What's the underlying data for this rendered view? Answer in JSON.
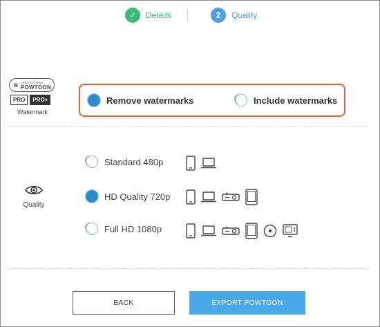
{
  "stepper": {
    "steps": [
      {
        "index": "✓",
        "label": "Details",
        "state": "complete",
        "color": "#3cb878"
      },
      {
        "index": "2",
        "label": "Quality",
        "state": "active",
        "color": "#4a9fe0"
      }
    ]
  },
  "watermark": {
    "badge_brand": "POWTOON",
    "badge_tiny": "CREATED USING",
    "plans": [
      "PRO",
      "PRO+"
    ],
    "section_label": "Watermark",
    "highlight_color": "#e8642f",
    "options": [
      {
        "label": "Remove watermarks",
        "selected": true
      },
      {
        "label": "Include watermarks",
        "selected": false
      }
    ]
  },
  "quality": {
    "section_label": "Quality",
    "section_icon": "eye-icon",
    "options": [
      {
        "label": "Standard 480p",
        "selected": false,
        "devices": [
          "phone-icon",
          "laptop-icon"
        ]
      },
      {
        "label": "HD Quality 720p",
        "selected": true,
        "devices": [
          "phone-icon",
          "laptop-icon",
          "projector-icon",
          "tablet-icon"
        ]
      },
      {
        "label": "Full HD 1080p",
        "selected": false,
        "devices": [
          "phone-icon",
          "laptop-icon",
          "projector-icon",
          "tablet-icon",
          "disc-icon",
          "tv-icon"
        ]
      }
    ]
  },
  "actions": {
    "back_label": "BACK",
    "export_label": "EXPORT POWTOON",
    "accent": "#4aa8e8"
  }
}
